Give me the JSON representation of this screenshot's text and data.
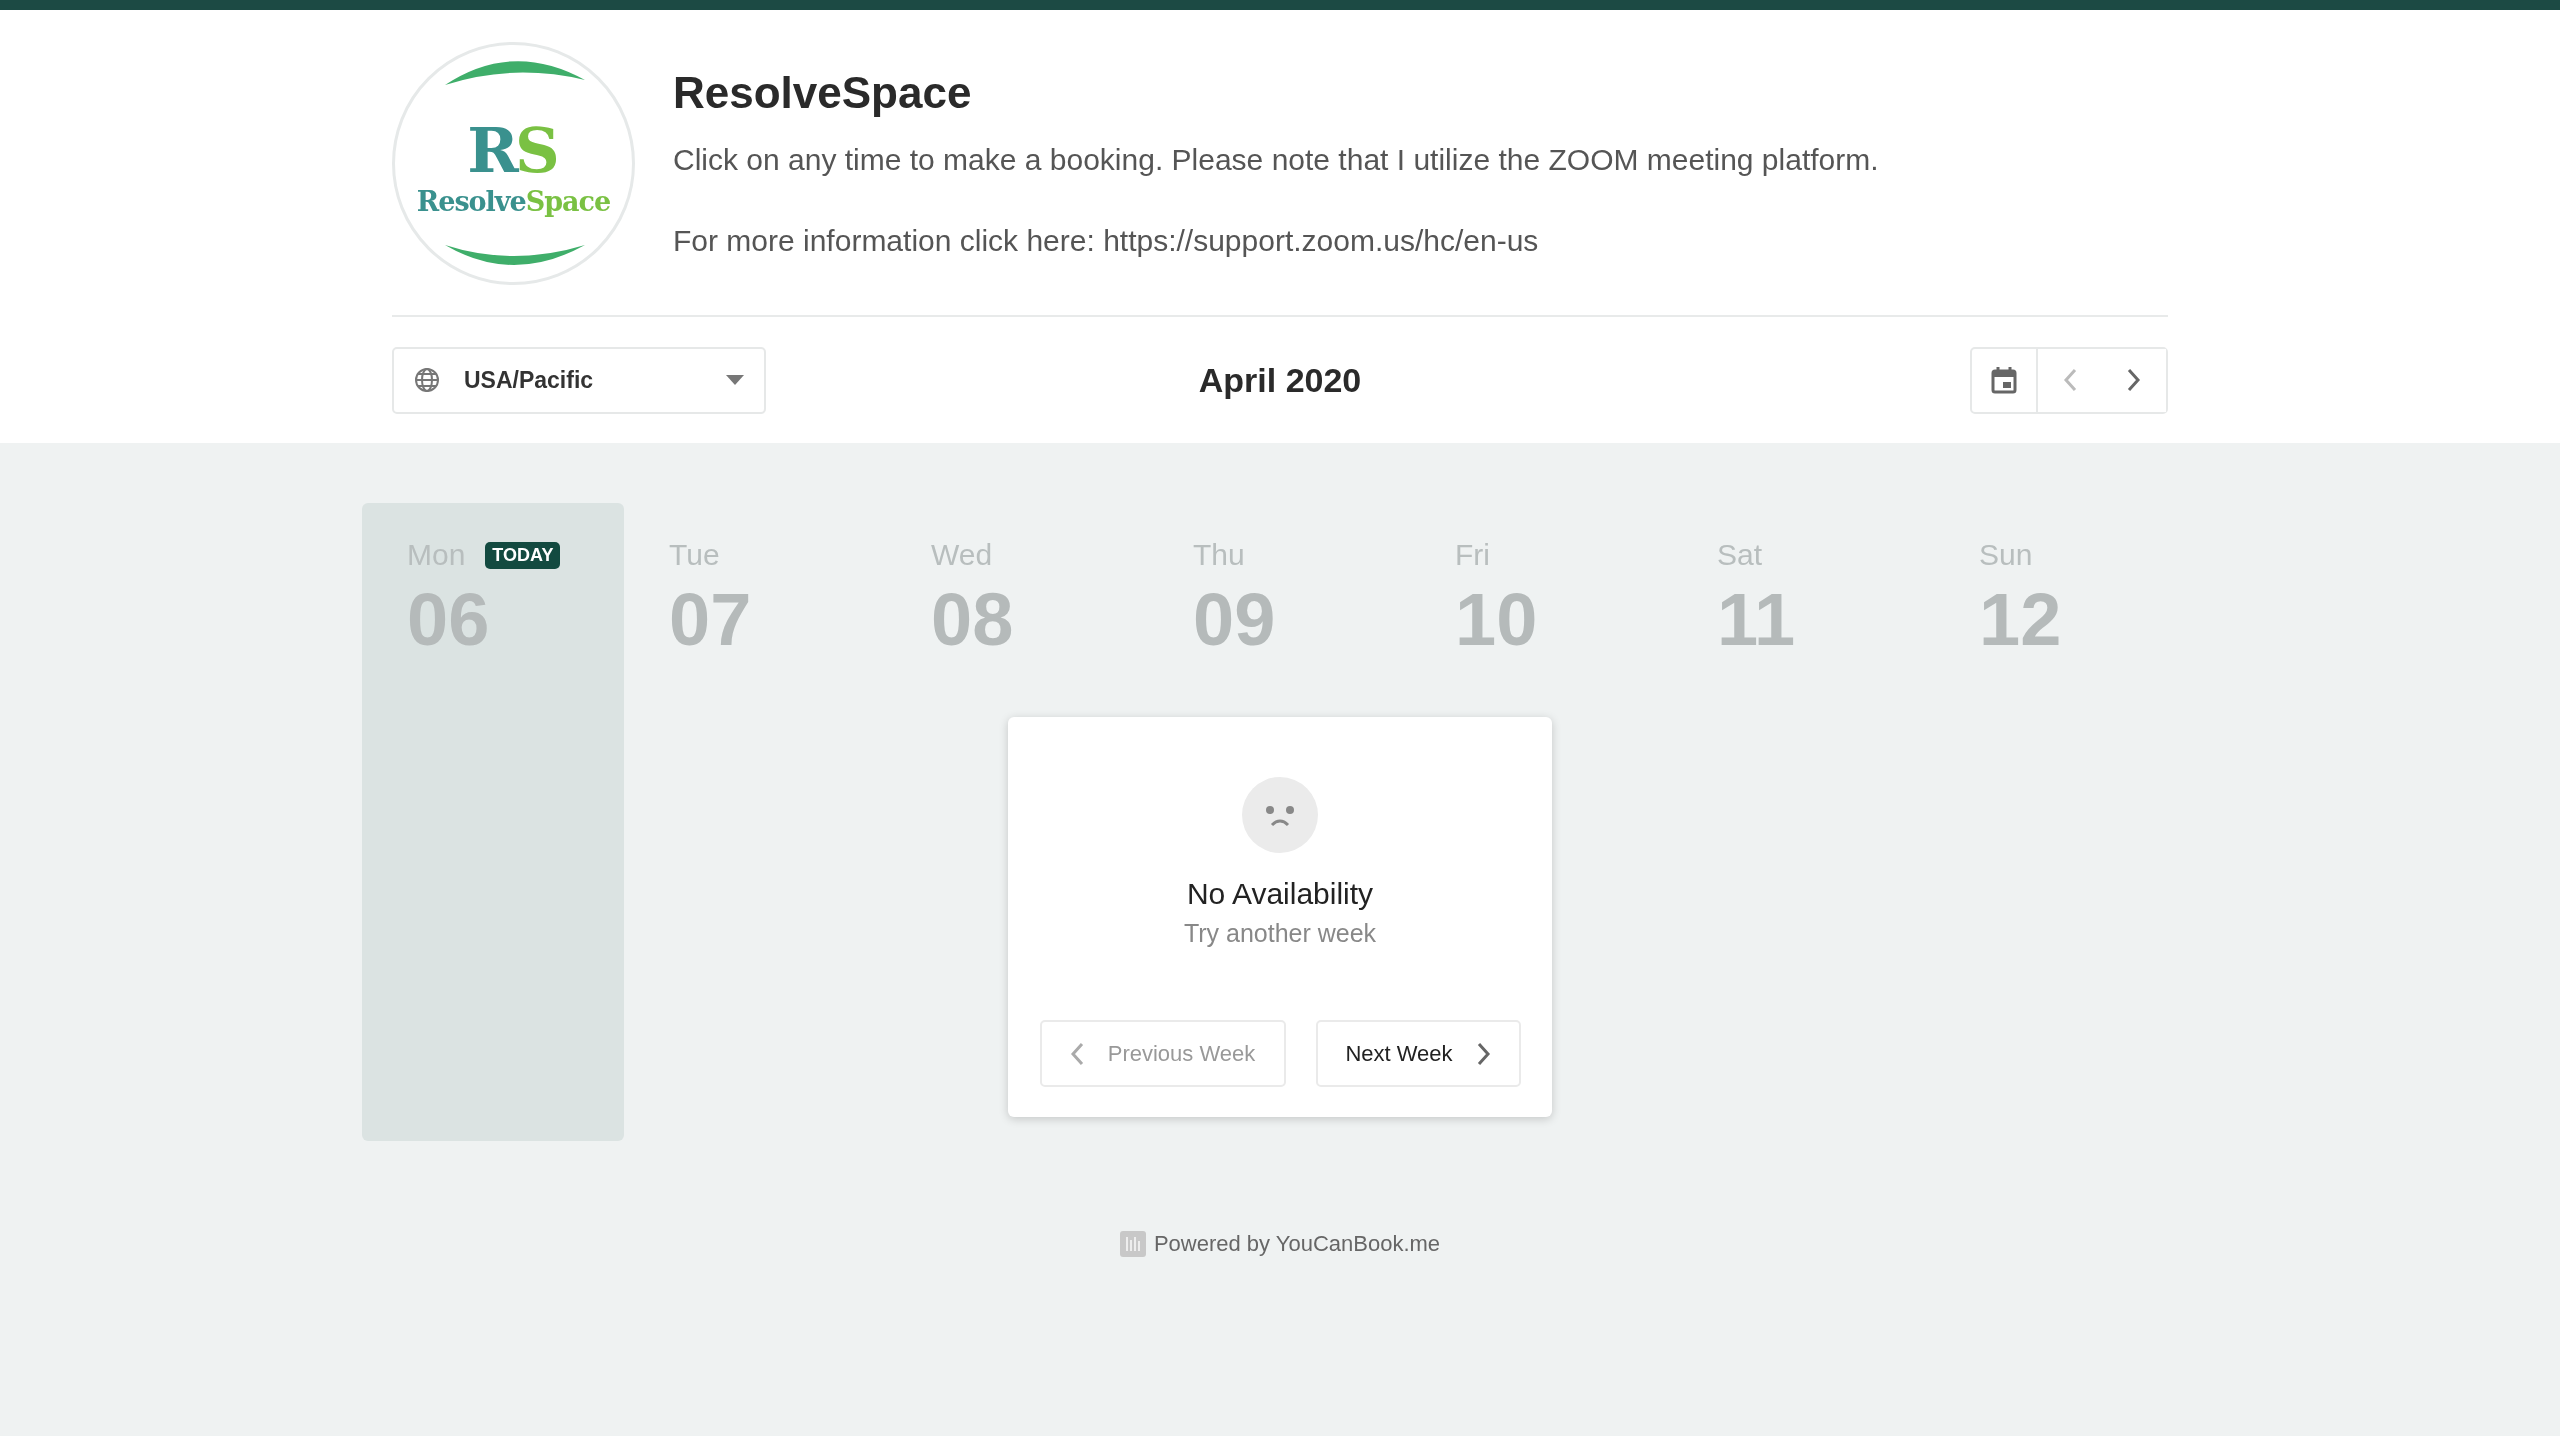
{
  "profile": {
    "logo_monogram": "RS",
    "logo_text_1": "Resolve",
    "logo_text_2": "Space",
    "title": "ResolveSpace",
    "description": "Click on any time to make a booking. Please note that I utilize the ZOOM meeting platform.",
    "info": "For more information click here: https://support.zoom.us/hc/en-us"
  },
  "toolbar": {
    "timezone": "USA/Pacific",
    "month": "April 2020"
  },
  "days": [
    {
      "name": "Mon",
      "number": "06",
      "today": true,
      "badge": "TODAY"
    },
    {
      "name": "Tue",
      "number": "07",
      "today": false
    },
    {
      "name": "Wed",
      "number": "08",
      "today": false
    },
    {
      "name": "Thu",
      "number": "09",
      "today": false
    },
    {
      "name": "Fri",
      "number": "10",
      "today": false
    },
    {
      "name": "Sat",
      "number": "11",
      "today": false
    },
    {
      "name": "Sun",
      "number": "12",
      "today": false
    }
  ],
  "empty_state": {
    "title": "No Availability",
    "subtitle": "Try another week",
    "buttons": [
      {
        "label": "Previous Week",
        "kind": "previous",
        "disabled": true
      },
      {
        "label": "Next Week",
        "kind": "next",
        "disabled": false
      }
    ]
  },
  "footer": {
    "text": "Powered by YouCanBook.me"
  }
}
